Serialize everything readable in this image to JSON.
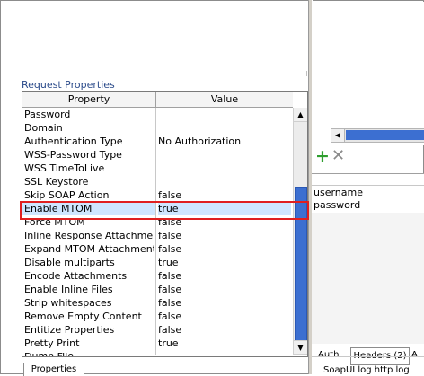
{
  "request_properties": {
    "title": "Request Properties",
    "columns": [
      "Property",
      "Value"
    ],
    "rows": [
      {
        "property": "Password",
        "value": ""
      },
      {
        "property": "Domain",
        "value": ""
      },
      {
        "property": "Authentication Type",
        "value": "No Authorization"
      },
      {
        "property": "WSS-Password Type",
        "value": ""
      },
      {
        "property": "WSS TimeToLive",
        "value": ""
      },
      {
        "property": "SSL Keystore",
        "value": ""
      },
      {
        "property": "Skip SOAP Action",
        "value": "false"
      },
      {
        "property": "Enable MTOM",
        "value": "true"
      },
      {
        "property": "Force MTOM",
        "value": "false"
      },
      {
        "property": "Inline Response Attachments",
        "value": "false"
      },
      {
        "property": "Expand MTOM Attachments",
        "value": "false"
      },
      {
        "property": "Disable multiparts",
        "value": "true"
      },
      {
        "property": "Encode Attachments",
        "value": "false"
      },
      {
        "property": "Enable Inline Files",
        "value": "false"
      },
      {
        "property": "Strip whitespaces",
        "value": "false"
      },
      {
        "property": "Remove Empty Content",
        "value": "false"
      },
      {
        "property": "Entitize Properties",
        "value": "false"
      },
      {
        "property": "Pretty Print",
        "value": "true"
      },
      {
        "property": "Dump File",
        "value": ""
      }
    ],
    "selected_row": "Enable MTOM",
    "tab_label": "Properties"
  },
  "right_panel": {
    "params": [
      "username",
      "password"
    ],
    "tabs": {
      "auth": "Auth",
      "headers": "Headers (2)",
      "attachments_initial": "A"
    },
    "bottom_text": "SoapUI log   http log"
  },
  "colors": {
    "highlight_border": "#e02020",
    "selection": "#cfe6ff",
    "scroll_thumb": "#3c6fd1",
    "title": "#2a4a8a"
  }
}
